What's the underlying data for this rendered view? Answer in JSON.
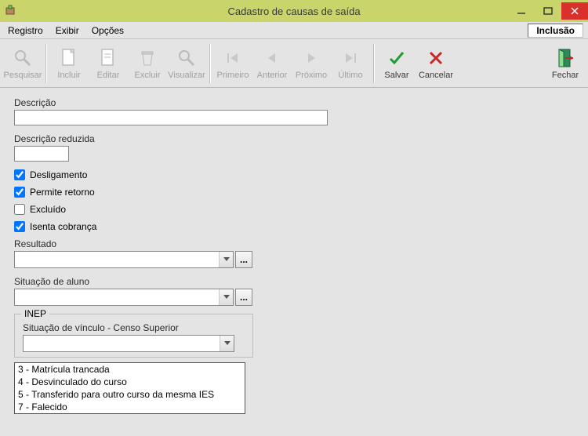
{
  "window": {
    "title": "Cadastro de causas de saída"
  },
  "menubar": {
    "items": [
      "Registro",
      "Exibir",
      "Opções"
    ],
    "mode": "Inclusão"
  },
  "toolbar": {
    "pesquisar": "Pesquisar",
    "incluir": "Incluir",
    "editar": "Editar",
    "excluir": "Excluir",
    "visualizar": "Visualizar",
    "primeiro": "Primeiro",
    "anterior": "Anterior",
    "proximo": "Próximo",
    "ultimo": "Último",
    "salvar": "Salvar",
    "cancelar": "Cancelar",
    "fechar": "Fechar"
  },
  "form": {
    "descricao_label": "Descrição",
    "descricao_value": "",
    "desc_red_label": "Descrição reduzida",
    "desc_red_value": "",
    "chk_desligamento": "Desligamento",
    "chk_retorno": "Permite retorno",
    "chk_excluido": "Excluído",
    "chk_isenta": "Isenta cobrança",
    "resultado_label": "Resultado",
    "resultado_value": "",
    "situacao_label": "Situação de aluno",
    "situacao_value": "",
    "inep": {
      "group_label": "INEP",
      "vinculo_label": "Situação de vínculo - Censo Superior",
      "vinculo_value": "",
      "options": [
        "3 - Matrícula trancada",
        "4 - Desvinculado do curso",
        "5 - Transferido para outro curso da mesma IES",
        "7 - Falecido"
      ]
    }
  }
}
